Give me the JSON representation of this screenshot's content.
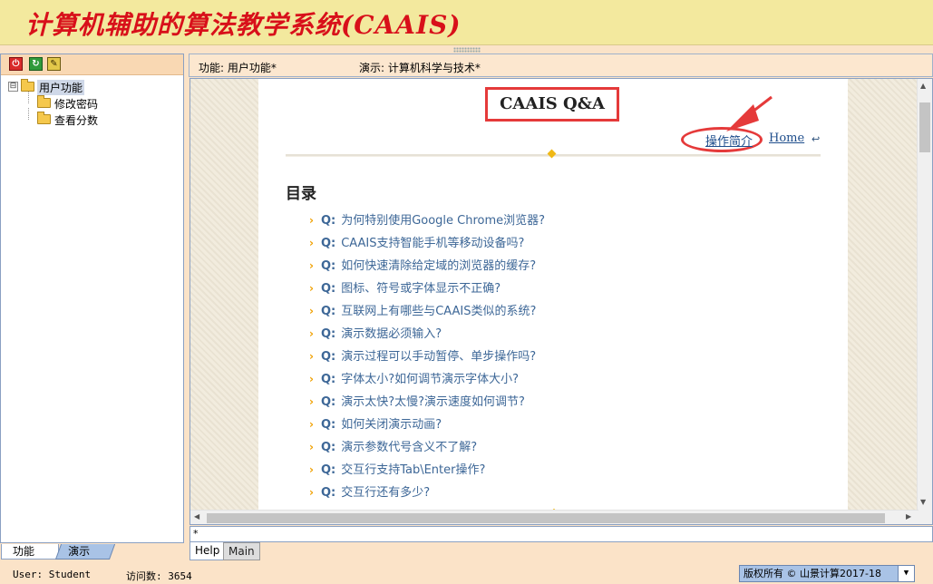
{
  "header": {
    "title": "计算机辅助的算法教学系统(CAAIS)"
  },
  "left_panel": {
    "toolbar": {
      "power_icon": "⏻",
      "refresh_icon": "↻",
      "edit_icon": "✎"
    },
    "tree": {
      "root": {
        "toggle": "⊟",
        "label": "用户功能"
      },
      "children": [
        {
          "label": "修改密码"
        },
        {
          "label": "查看分数"
        }
      ]
    },
    "tabs": [
      {
        "label": "功能"
      },
      {
        "label": "演示"
      }
    ]
  },
  "info_bar": {
    "func": "功能: 用户功能*",
    "demo": "演示: 计算机科学与技术*"
  },
  "document": {
    "title": "CAAIS Q&A",
    "ops_link": "操作简介",
    "home_link": "Home",
    "back_icon": "↩",
    "toc_heading": "目录",
    "faq_chevron": "›",
    "faq_prefix": "Q:",
    "faqs": [
      "为何特别使用Google Chrome浏览器?",
      "CAAIS支持智能手机等移动设备吗?",
      "如何快速清除给定域的浏览器的缓存?",
      "图标、符号或字体显示不正确?",
      "互联网上有哪些与CAAIS类似的系统?",
      "演示数据必须输入?",
      "演示过程可以手动暂停、单步操作吗?",
      "字体太小?如何调节演示字体大小?",
      "演示太快?太慢?演示速度如何调节?",
      "如何关闭演示动画?",
      "演示参数代号含义不了解?",
      "交互行支持Tab\\Enter操作?",
      "交互行还有多少?"
    ]
  },
  "scrollbar": {
    "up": "▲",
    "down": "▼",
    "left": "◀",
    "right": "▶"
  },
  "star_bar": {
    "text": "*"
  },
  "bottom_tabs": [
    {
      "label": "Help"
    },
    {
      "label": "Main"
    }
  ],
  "status": {
    "user": "User: Student",
    "visits": "访问数: 3654",
    "copyright": "版权所有 © 山景计算2017-18",
    "dropdown": "▼"
  },
  "colors": {
    "title_red": "#d8101a",
    "annotation_red": "#e53a3a",
    "link_blue": "#3d6797",
    "accent_gold": "#f0b814"
  }
}
